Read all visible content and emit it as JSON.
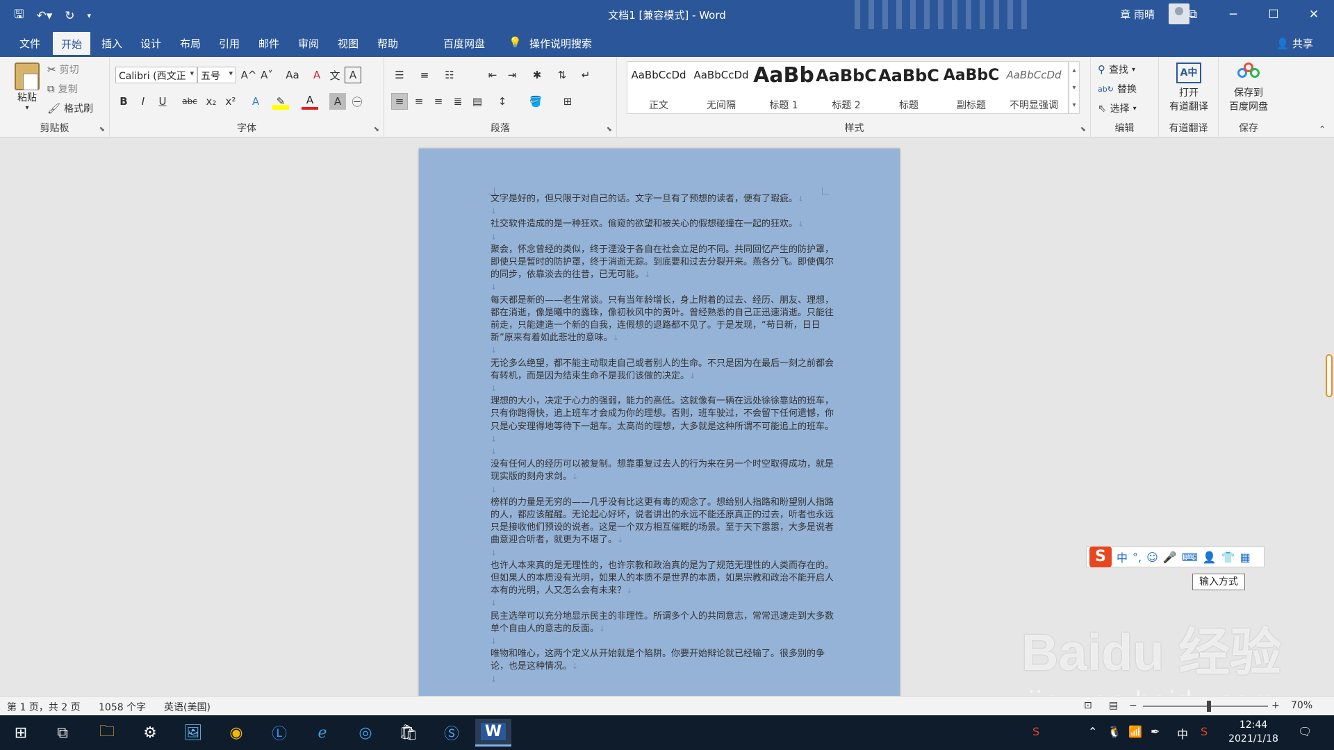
{
  "window": {
    "title": "文档1 [兼容模式] - Word",
    "user": "章 雨晴",
    "qat": {
      "save": "🖫",
      "undo": "↶▾",
      "redo": "↻",
      "customize": "▾"
    },
    "buttons": {
      "restore_ribbon": "⧉",
      "minimize": "─",
      "maximize": "☐",
      "close": "✕"
    }
  },
  "tabs": [
    "文件",
    "开始",
    "插入",
    "设计",
    "布局",
    "引用",
    "邮件",
    "审阅",
    "视图",
    "帮助",
    "百度网盘",
    "操作说明搜索"
  ],
  "active_tab": "开始",
  "share_label": "共享",
  "ribbon": {
    "clipboard": {
      "label": "剪贴板",
      "paste": "粘贴",
      "cut": "剪切",
      "copy": "复制",
      "format_painter": "格式刷"
    },
    "font": {
      "label": "字体",
      "font_name": "Calibri (西文正",
      "font_size": "五号",
      "bold": "B",
      "italic": "I",
      "underline": "U",
      "strike": "abc",
      "sub": "x₂",
      "sup": "x²",
      "grow": "A^",
      "shrink": "A˅",
      "case": "Aa",
      "clear": "A",
      "phonetic": "文",
      "border_char": "A"
    },
    "paragraph": {
      "label": "段落"
    },
    "styles": {
      "label": "样式",
      "items": [
        {
          "preview": "AaBbCcDd",
          "name": "正文"
        },
        {
          "preview": "AaBbCcDd",
          "name": "无间隔"
        },
        {
          "preview": "AaBb",
          "name": "标题 1"
        },
        {
          "preview": "AaBbC",
          "name": "标题 2"
        },
        {
          "preview": "AaBbC",
          "name": "标题"
        },
        {
          "preview": "AaBbC",
          "name": "副标题"
        },
        {
          "preview": "AaBbCcDd",
          "name": "不明显强调"
        }
      ]
    },
    "editing": {
      "label": "编辑",
      "find": "查找",
      "replace": "替换",
      "select": "选择"
    },
    "youdao": {
      "label": "有道翻译",
      "open": "打开",
      "open2": "有道翻译"
    },
    "save": {
      "label": "保存",
      "save1": "保存到",
      "save2": "百度网盘"
    }
  },
  "document": {
    "paragraphs": [
      "文字是好的，但只限于对自己的话。文字一旦有了预想的读者，便有了瑕疵。",
      "社交软件造成的是一种狂欢。偷窥的欲望和被关心的假想碰撞在一起的狂欢。",
      "聚会，怀念曾经的类似，终于湮没于各自在社会立足的不同。共同回忆产生的防护罩，即使只是暂时的防护罩，终于消逝无踪。到底要和过去分裂开来。燕各分飞。即使偶尔的同步，依靠淡去的往昔，已无可能。",
      "每天都是新的——老生常谈。只有当年龄增长，身上附着的过去、经历、朋友、理想，都在消逝，像是曦中的露珠，像初秋风中的黄叶。曾经熟悉的自己正迅速消逝。只能往前走，只能建造一个新的自我，连假想的退路都不见了。于是发现，“苟日新，日日新”原来有着如此悲壮的意味。",
      "无论多么绝望，都不能主动取走自己或者别人的生命。不只是因为在最后一刻之前都会有转机，而是因为结束生命不是我们该做的决定。",
      "理想的大小，决定于心力的强弱，能力的高低。这就像有一辆在远处徐徐靠站的班车，只有你跑得快，追上班车才会成为你的理想。否则，班车驶过，不会留下任何遗憾，你只是心安理得地等待下一趟车。太高尚的理想，大多就是这种所谓不可能追上的班车。",
      "没有任何人的经历可以被复制。想靠重复过去人的行为来在另一个时空取得成功，就是现实版的刻舟求剑。",
      "榜样的力量是无穷的——几乎没有比这更有毒的观念了。想给别人指路和盼望别人指路的人，都应该醒醒。无论起心好坏，说者讲出的永远不能还原真正的过去，听者也永远只是接收他们预设的说者。这是一个双方相互催眠的场景。至于天下嚣嚣，大多是说者曲意迎合听者，就更为不堪了。",
      "也许人本来真的是无理性的，也许宗教和政治真的是为了规范无理性的人类而存在的。但如果人的本质没有光明，如果人的本质不是世界的本质，如果宗教和政治不能开启人本有的光明，人又怎么会有未来？",
      "民主选举可以充分地显示民主的非理性。所谓多个人的共同意志，常常迅速走到大多数单个自由人的意志的反面。",
      "唯物和唯心，这两个定义从开始就是个陷阱。你要开始辩论就已经输了。很多别的争论，也是这种情况。"
    ]
  },
  "ime": {
    "logo": "S",
    "items": [
      "中",
      "°,",
      "☺",
      "🎤",
      "⌨",
      "👤",
      "👕",
      "▦"
    ],
    "tooltip": "输入方式"
  },
  "watermark": {
    "main": "Baidu 经验",
    "sub": "jingyan.baidu.com"
  },
  "status": {
    "page": "第 1 页，共 2 页",
    "words": "1058 个字",
    "lang": "英语(美国)",
    "zoom": "70%",
    "zoom_level": 0.7
  },
  "taskbar": {
    "time": "12:44",
    "date": "2021/1/18",
    "ime_lang": "中"
  }
}
